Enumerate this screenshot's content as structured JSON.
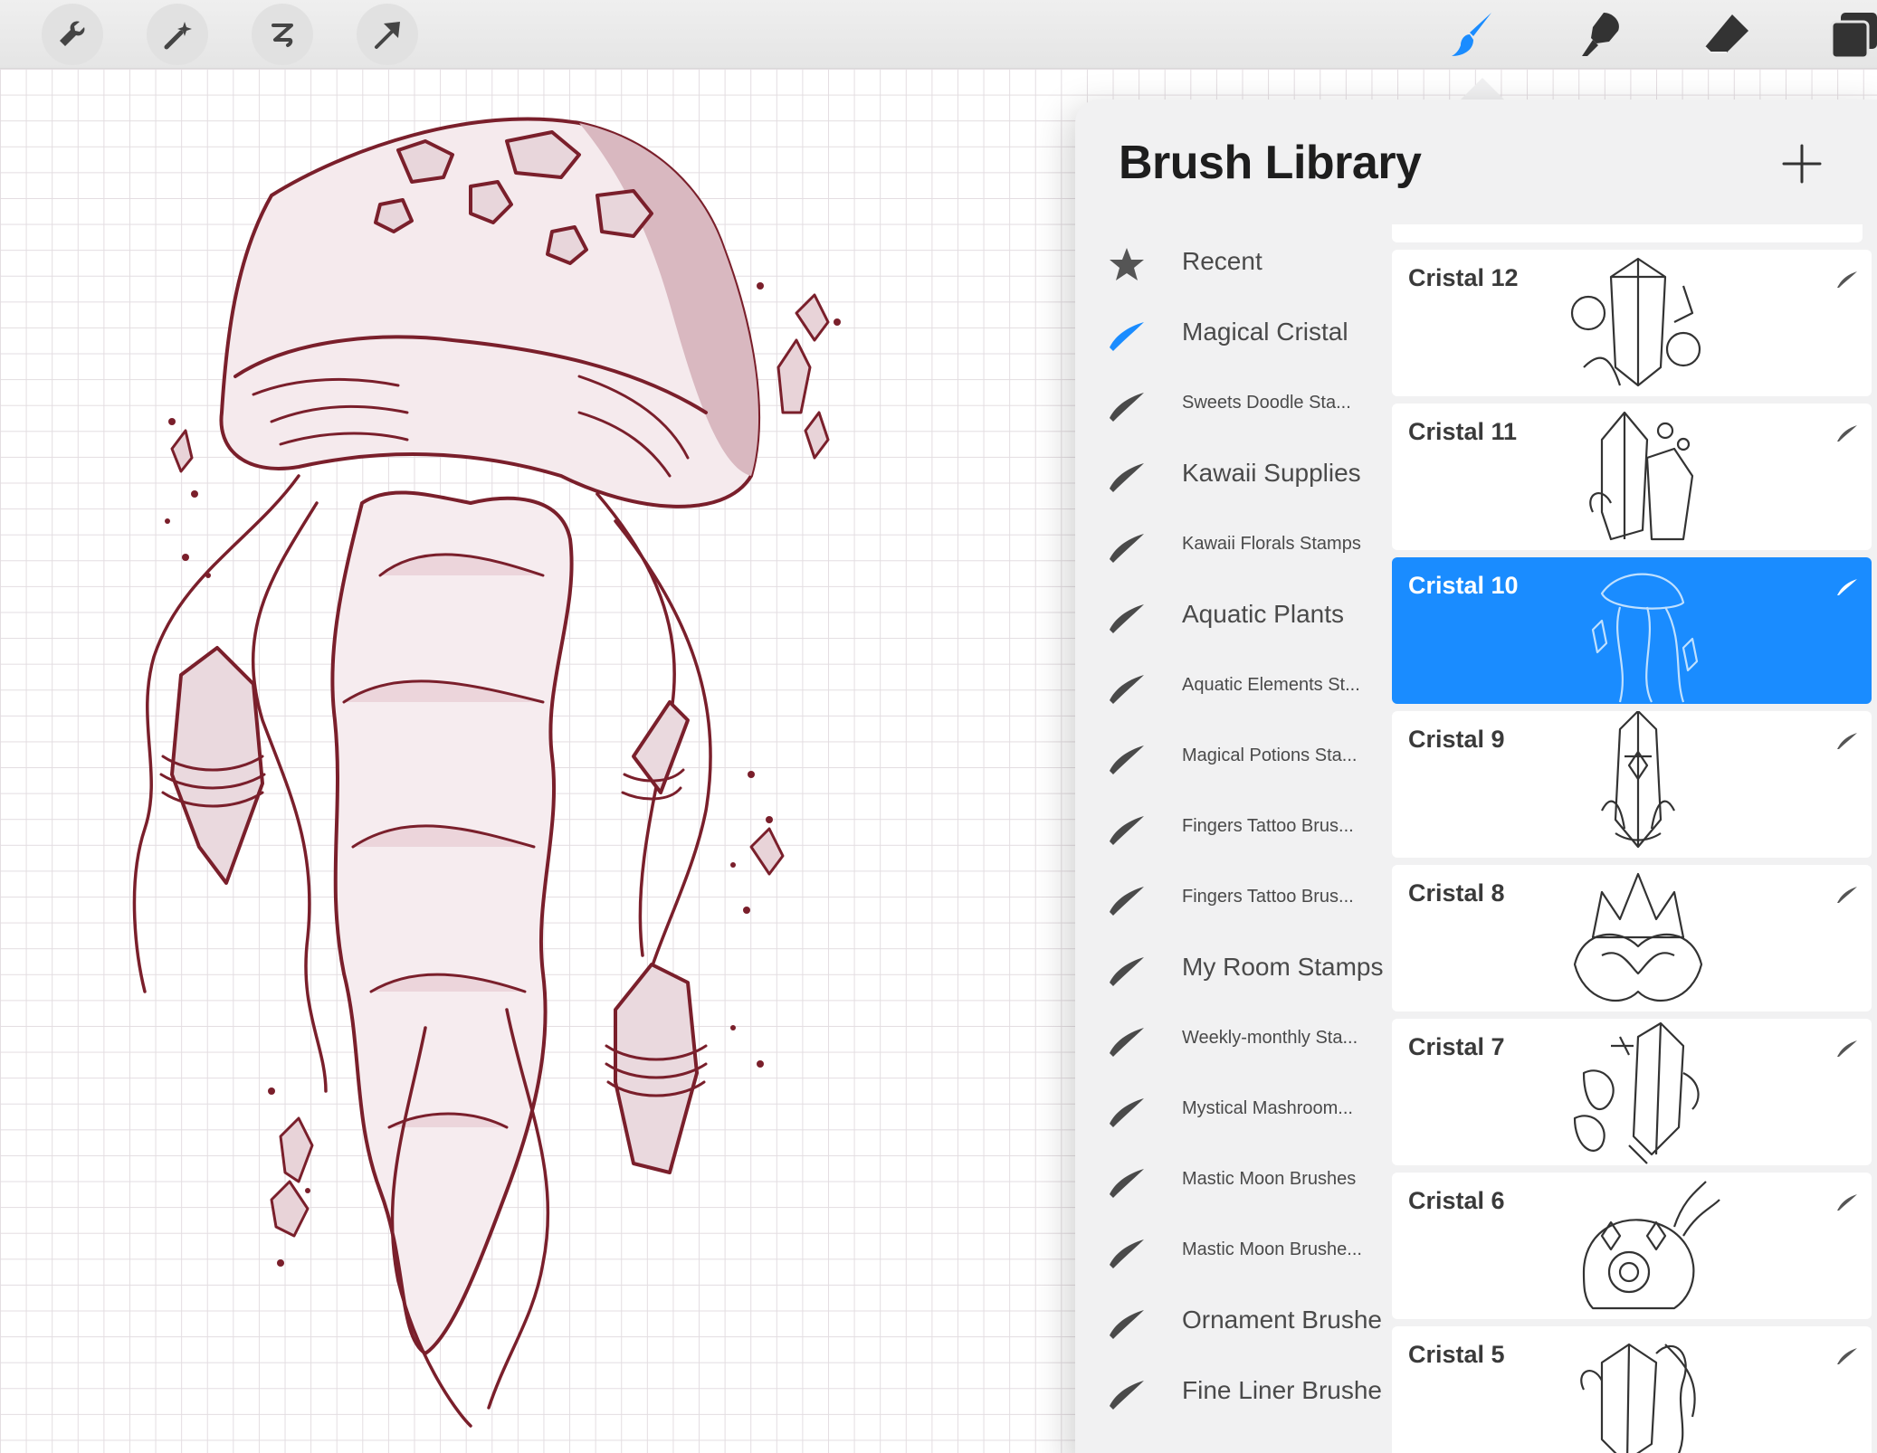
{
  "toolbar": {
    "left_tools": [
      "wrench-icon",
      "magic-wand-icon",
      "selection-icon",
      "transform-arrow-icon"
    ],
    "right_tools": [
      "brush-icon",
      "smudge-icon",
      "eraser-icon",
      "layers-icon"
    ],
    "active_tool": "brush-icon",
    "active_color": "#1a8cff"
  },
  "popover": {
    "title": "Brush Library",
    "add_icon": "plus-icon"
  },
  "brush_sets": [
    {
      "label": "Recent",
      "icon": "star-icon",
      "size": "big"
    },
    {
      "label": "Magical Cristal",
      "icon": "brush-stroke-icon",
      "size": "big",
      "selected": true
    },
    {
      "label": "Sweets Doodle Sta...",
      "icon": "brush-stroke-icon",
      "size": "small"
    },
    {
      "label": "Kawaii Supplies",
      "icon": "brush-stroke-icon",
      "size": "big"
    },
    {
      "label": "Kawaii Florals Stamps",
      "icon": "brush-stroke-icon",
      "size": "small"
    },
    {
      "label": "Aquatic Plants",
      "icon": "brush-stroke-icon",
      "size": "big"
    },
    {
      "label": "Aquatic Elements St...",
      "icon": "brush-stroke-icon",
      "size": "small"
    },
    {
      "label": "Magical Potions Sta...",
      "icon": "brush-stroke-icon",
      "size": "small"
    },
    {
      "label": "Fingers Tattoo Brus...",
      "icon": "brush-stroke-icon",
      "size": "small"
    },
    {
      "label": "Fingers Tattoo Brus...",
      "icon": "brush-stroke-icon",
      "size": "small"
    },
    {
      "label": "My Room Stamps",
      "icon": "brush-stroke-icon",
      "size": "big"
    },
    {
      "label": "Weekly-monthly Sta...",
      "icon": "brush-stroke-icon",
      "size": "small"
    },
    {
      "label": "Mystical Mashroom...",
      "icon": "brush-stroke-icon",
      "size": "small"
    },
    {
      "label": "Mastic Moon Brushes",
      "icon": "brush-stroke-icon",
      "size": "small"
    },
    {
      "label": "Mastic Moon Brushe...",
      "icon": "brush-stroke-icon",
      "size": "small"
    },
    {
      "label": "Ornament Brushes",
      "icon": "brush-stroke-icon",
      "size": "big"
    },
    {
      "label": "Fine Liner Brushes",
      "icon": "brush-stroke-icon",
      "size": "big"
    }
  ],
  "brushes": [
    {
      "name": "Cristal 12",
      "selected": false
    },
    {
      "name": "Cristal 11",
      "selected": false
    },
    {
      "name": "Cristal 10",
      "selected": true
    },
    {
      "name": "Cristal 9",
      "selected": false
    },
    {
      "name": "Cristal 8",
      "selected": false
    },
    {
      "name": "Cristal 7",
      "selected": false
    },
    {
      "name": "Cristal 6",
      "selected": false
    },
    {
      "name": "Cristal 5",
      "selected": false
    }
  ],
  "colors": {
    "accent": "#1a8cff",
    "artwork_line": "#7a1f2b",
    "artwork_shade": "#d9b8c0"
  }
}
